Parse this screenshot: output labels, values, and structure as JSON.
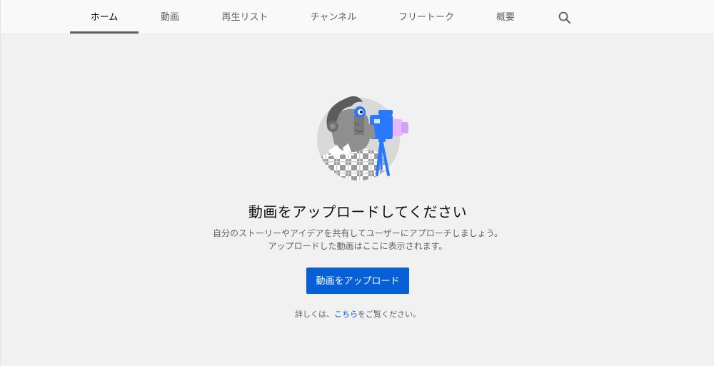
{
  "tabs": [
    {
      "label": "ホーム",
      "active": true
    },
    {
      "label": "動画",
      "active": false
    },
    {
      "label": "再生リスト",
      "active": false
    },
    {
      "label": "チャンネル",
      "active": false
    },
    {
      "label": "フリートーク",
      "active": false
    },
    {
      "label": "概要",
      "active": false
    }
  ],
  "search_icon": "search-icon",
  "empty_state": {
    "illustration": "videographer-illustration",
    "title": "動画をアップロードしてください",
    "description_line1": "自分のストーリーやアイデアを共有してユーザーにアプローチしましょう。",
    "description_line2": "アップロードした動画はここに表示されます。",
    "upload_button_label": "動画をアップロード",
    "learn_more_prefix": "詳しくは、",
    "learn_more_link": "こちら",
    "learn_more_suffix": "をご覧ください。"
  },
  "colors": {
    "accent": "#065fd4",
    "background": "#f1f1f1",
    "tabbar": "#f9f9f9",
    "text_primary": "#0f0f0f",
    "text_secondary": "#606060"
  }
}
